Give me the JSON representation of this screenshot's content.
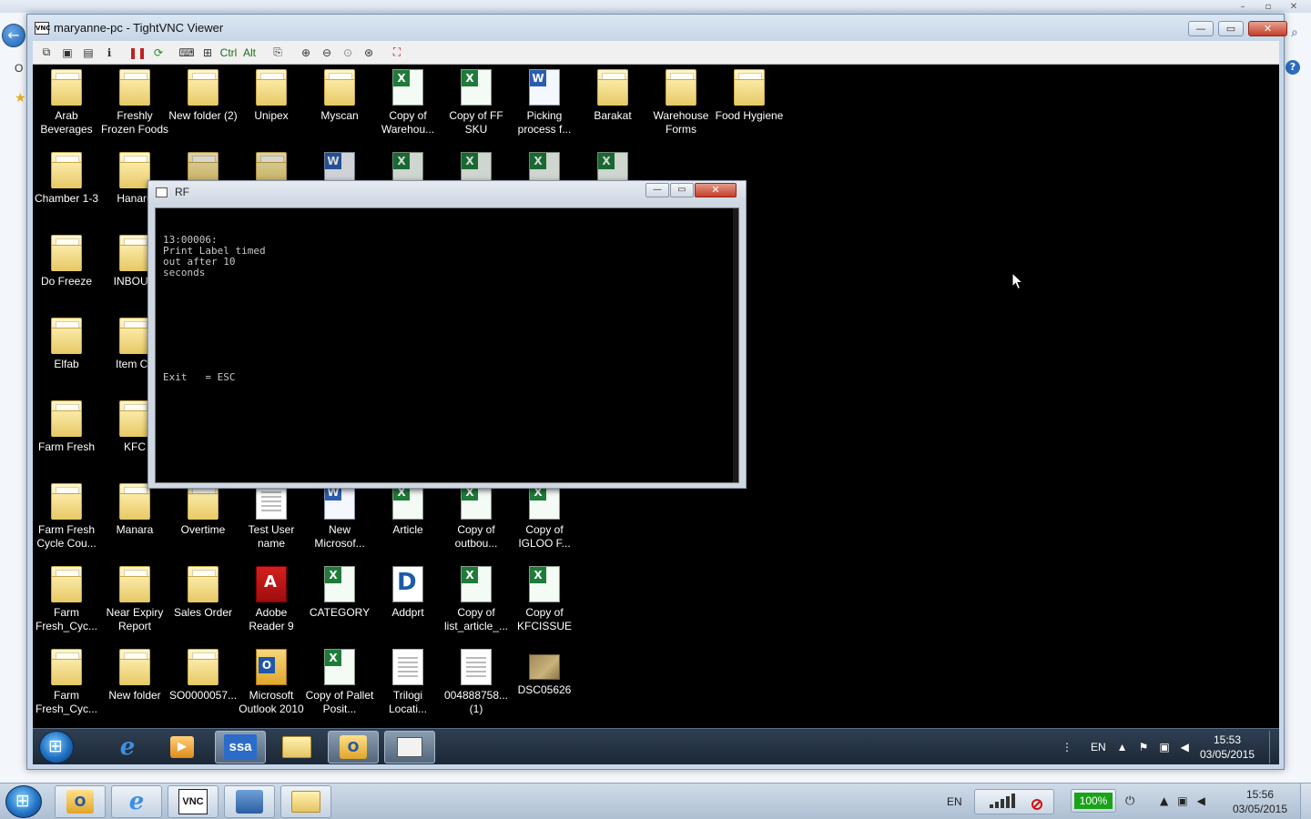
{
  "vnc": {
    "title": "maryanne-pc - TightVNC Viewer",
    "icon_text": "VNC",
    "toolbar": {
      "ctrl_label": "Ctrl",
      "alt_label": "Alt"
    }
  },
  "desktop": {
    "icons": [
      {
        "label": "Arab Beverages",
        "type": "folder"
      },
      {
        "label": "Freshly Frozen Foods",
        "type": "folder"
      },
      {
        "label": "New folder (2)",
        "type": "folder"
      },
      {
        "label": "Unipex",
        "type": "folder"
      },
      {
        "label": "Myscan",
        "type": "folder"
      },
      {
        "label": "Copy of Warehou...",
        "type": "excel"
      },
      {
        "label": "Copy of FF SKU",
        "type": "excel"
      },
      {
        "label": "Picking process f...",
        "type": "word"
      },
      {
        "label": "Barakat",
        "type": "folder"
      },
      {
        "label": "Warehouse Forms",
        "type": "folder"
      },
      {
        "label": "Food Hygiene",
        "type": "folder"
      },
      {
        "label": "Chamber 1-3",
        "type": "folder"
      },
      {
        "label": "Hanaru",
        "type": "folder"
      },
      {
        "label": "Do Freeze",
        "type": "folder"
      },
      {
        "label": "INBOUN",
        "type": "folder"
      },
      {
        "label": "Elfab",
        "type": "folder"
      },
      {
        "label": "Item Co",
        "type": "folder"
      },
      {
        "label": "Farm Fresh",
        "type": "folder"
      },
      {
        "label": "KFC",
        "type": "folder"
      },
      {
        "label": "Farm Fresh Cycle Cou...",
        "type": "folder"
      },
      {
        "label": "Manara",
        "type": "folder"
      },
      {
        "label": "Overtime",
        "type": "folder"
      },
      {
        "label": "Test User name",
        "type": "doc"
      },
      {
        "label": "New Microsof...",
        "type": "word"
      },
      {
        "label": "Article",
        "type": "excel"
      },
      {
        "label": "Copy of outbou...",
        "type": "excel"
      },
      {
        "label": "Copy of IGLOO F...",
        "type": "excel"
      },
      {
        "label": "Farm Fresh_Cyc...",
        "type": "folder"
      },
      {
        "label": "Near Expiry Report",
        "type": "folder"
      },
      {
        "label": "Sales Order",
        "type": "folder"
      },
      {
        "label": "Adobe Reader 9",
        "type": "pdf"
      },
      {
        "label": "CATEGORY",
        "type": "excel"
      },
      {
        "label": "Addprt",
        "type": "addprt"
      },
      {
        "label": "Copy of list_article_...",
        "type": "excel"
      },
      {
        "label": "Copy of KFCISSUE",
        "type": "excel"
      },
      {
        "label": "Farm Fresh_Cyc...",
        "type": "folder"
      },
      {
        "label": "New folder",
        "type": "folder"
      },
      {
        "label": "SO0000057...",
        "type": "folder"
      },
      {
        "label": "Microsoft Outlook 2010",
        "type": "outlook"
      },
      {
        "label": "Copy of Pallet Posit...",
        "type": "excel"
      },
      {
        "label": "Trilogi Locati...",
        "type": "doc"
      },
      {
        "label": "004888758... (1)",
        "type": "doc"
      },
      {
        "label": "DSC05626",
        "type": "photo"
      }
    ]
  },
  "rf": {
    "title": "RF",
    "console_lines": "13:00006:\nPrint Label timed\nout after 10\nseconds",
    "exit_line": "Exit   = ESC"
  },
  "remote_taskbar": {
    "tasks": [
      {
        "name": "internet-explorer"
      },
      {
        "name": "media-player"
      },
      {
        "name": "ssa",
        "text": "ssa"
      },
      {
        "name": "windows-explorer"
      },
      {
        "name": "outlook"
      },
      {
        "name": "rf-console"
      }
    ],
    "language": "EN",
    "time": "15:53",
    "date": "03/05/2015"
  },
  "host_taskbar": {
    "tasks": [
      {
        "name": "outlook"
      },
      {
        "name": "internet-explorer"
      },
      {
        "name": "tightvnc",
        "text": "VNC"
      },
      {
        "name": "remote-desktop"
      },
      {
        "name": "windows-explorer"
      }
    ],
    "language": "EN",
    "battery": "100%",
    "time": "15:56",
    "date": "03/05/2015"
  },
  "host": {
    "left_letter": "O"
  }
}
